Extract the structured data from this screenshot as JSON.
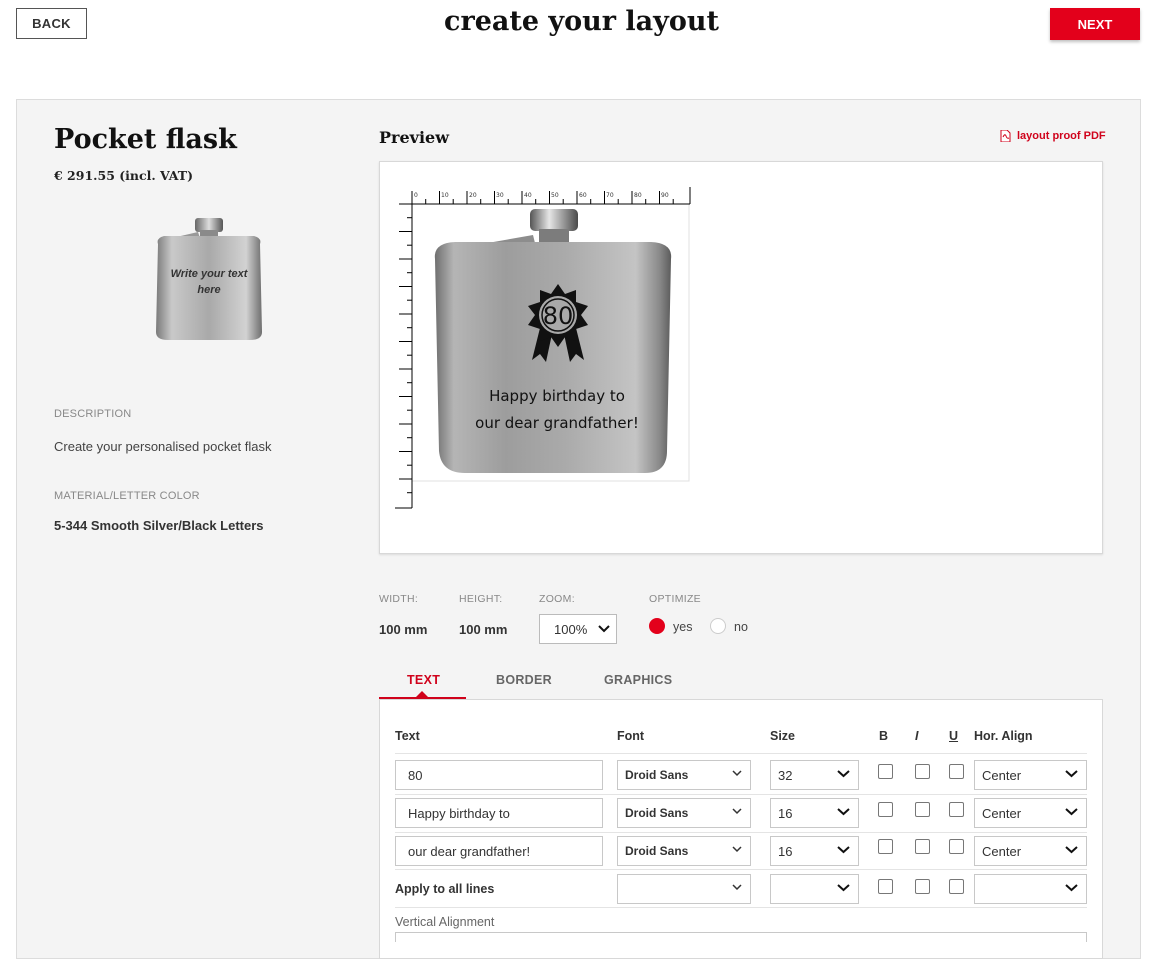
{
  "header": {
    "back_label": "BACK",
    "title": "create your layout",
    "next_label": "NEXT"
  },
  "product": {
    "name": "Pocket flask",
    "price": "€ 291.55 (incl. VAT)",
    "thumbnail_text_line1": "Write your text",
    "thumbnail_text_line2": "here",
    "description_label": "DESCRIPTION",
    "description": "Create your personalised pocket flask",
    "material_label": "MATERIAL/LETTER COLOR",
    "material": "5-344 Smooth Silver/Black Letters"
  },
  "preview": {
    "title": "Preview",
    "pdf_link": "layout proof PDF",
    "ruler_labels": [
      "0",
      "10",
      "20",
      "30",
      "40",
      "50",
      "60",
      "70",
      "80",
      "90"
    ],
    "badge_number": "80",
    "engraving_line1": "Happy birthday to",
    "engraving_line2": "our dear grandfather!"
  },
  "controls": {
    "width_label": "WIDTH:",
    "width_value": "100 mm",
    "height_label": "HEIGHT:",
    "height_value": "100 mm",
    "zoom_label": "ZOOM:",
    "zoom_value": "100%",
    "optimize_label": "OPTIMIZE",
    "optimize_yes": "yes",
    "optimize_no": "no",
    "optimize_selected": "yes"
  },
  "tabs": [
    "TEXT",
    "BORDER",
    "GRAPHICS"
  ],
  "active_tab": "TEXT",
  "text_table": {
    "headers": {
      "text": "Text",
      "font": "Font",
      "size": "Size",
      "bold": "B",
      "italic": "I",
      "underline": "U",
      "align": "Hor. Align"
    },
    "rows": [
      {
        "text": "80",
        "font": "Droid Sans",
        "size": "32",
        "align": "Center"
      },
      {
        "text": "Happy birthday to",
        "font": "Droid Sans",
        "size": "16",
        "align": "Center"
      },
      {
        "text": "our dear grandfather!",
        "font": "Droid Sans",
        "size": "16",
        "align": "Center"
      }
    ],
    "apply_all_label": "Apply to all lines",
    "vertical_alignment_label": "Vertical Alignment"
  },
  "colors": {
    "accent": "#e3001b",
    "panel_bg": "#f4f4f4"
  }
}
